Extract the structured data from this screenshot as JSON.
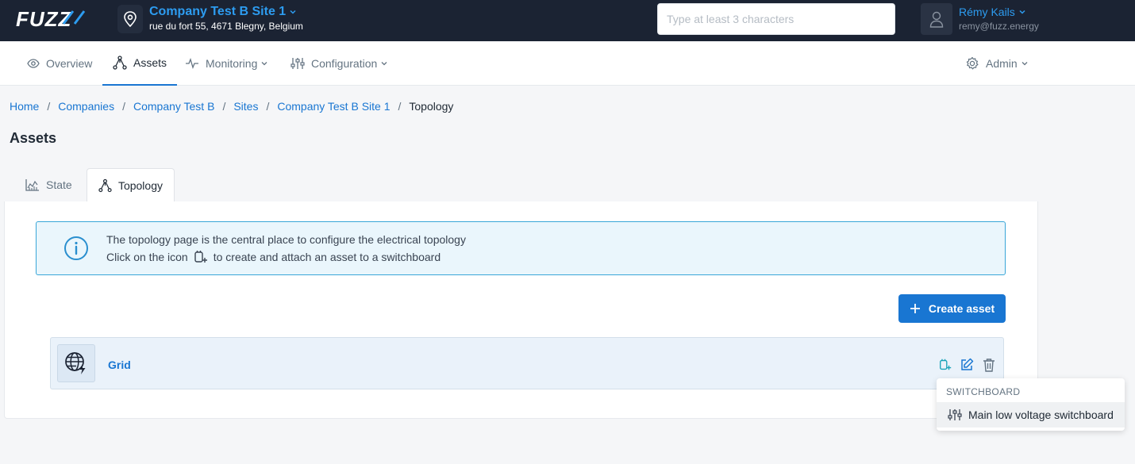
{
  "brand": {
    "logo_text": "FUZZ"
  },
  "site": {
    "title": "Company Test B Site 1",
    "address": "rue du fort 55, 4671 Blegny, Belgium"
  },
  "search": {
    "placeholder": "Type at least 3 characters",
    "value": ""
  },
  "user": {
    "name": "Rémy Kails",
    "email": "remy@fuzz.energy"
  },
  "nav": {
    "overview": "Overview",
    "assets": "Assets",
    "monitoring": "Monitoring",
    "configuration": "Configuration",
    "admin": "Admin"
  },
  "breadcrumb": {
    "items": [
      "Home",
      "Companies",
      "Company Test B",
      "Sites",
      "Company Test B Site 1"
    ],
    "separator": "/",
    "current": "Topology"
  },
  "page": {
    "title": "Assets"
  },
  "tabs": {
    "state": "State",
    "topology": "Topology",
    "active": "topology"
  },
  "info": {
    "line1": "The topology page is the central place to configure the electrical topology",
    "line2_before": "Click on the icon",
    "line2_after": "to create and attach an asset to a switchboard"
  },
  "actions": {
    "create_asset": "Create asset"
  },
  "assets": [
    {
      "name": "Grid",
      "icon": "grid-globe-icon"
    }
  ],
  "dropdown": {
    "header": "SWITCHBOARD",
    "items": [
      {
        "label": "Main low voltage switchboard",
        "icon": "sliders-icon"
      }
    ]
  },
  "colors": {
    "topbar": "#1b2333",
    "accent": "#1976d2",
    "link": "#2d9cf0",
    "teal": "#19a3b8",
    "info_bg": "#eaf6fc",
    "info_border": "#39a6d8"
  }
}
